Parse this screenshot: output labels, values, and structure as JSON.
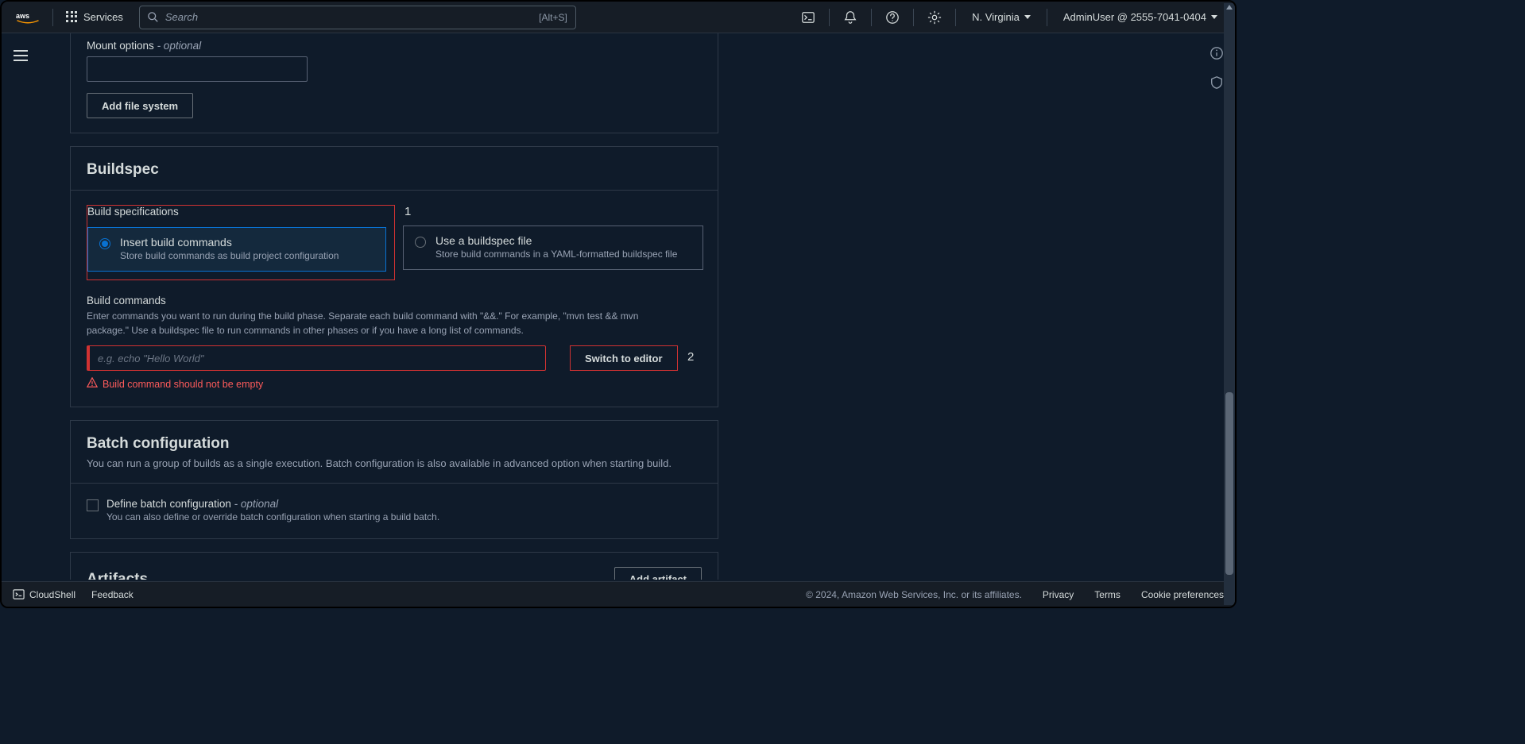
{
  "nav": {
    "services_label": "Services",
    "search_placeholder": "Search",
    "search_shortcut": "[Alt+S]",
    "region": "N. Virginia",
    "account": "AdminUser @ 2555-7041-0404"
  },
  "mount": {
    "label": "Mount options ",
    "optional": "- optional",
    "add_fs_btn": "Add file system"
  },
  "buildspec": {
    "title": "Buildspec",
    "spec_label": "Build specifications",
    "callout1": "1",
    "insert_title": "Insert build commands",
    "insert_desc": "Store build commands as build project configuration",
    "usefile_title": "Use a buildspec file",
    "usefile_desc": "Store build commands in a YAML-formatted buildspec file",
    "commands_label": "Build commands",
    "commands_help": "Enter commands you want to run during the build phase. Separate each build command with \"&&.\" For example, \"mvn test && mvn package.\" Use a buildspec file to run commands in other phases or if you have a long list of commands.",
    "commands_placeholder": "e.g. echo \"Hello World\"",
    "switch_btn": "Switch to editor",
    "callout2": "2",
    "error_msg": "Build command should not be empty"
  },
  "batch": {
    "title": "Batch configuration",
    "subtitle": "You can run a group of builds as a single execution. Batch configuration is also available in advanced option when starting build.",
    "checkbox_label": "Define batch configuration ",
    "checkbox_optional": "- optional",
    "checkbox_desc": "You can also define or override batch configuration when starting a build batch."
  },
  "artifacts": {
    "title": "Artifacts",
    "add_btn": "Add artifact"
  },
  "footer": {
    "cloudshell": "CloudShell",
    "feedback": "Feedback",
    "copyright": "© 2024, Amazon Web Services, Inc. or its affiliates.",
    "privacy": "Privacy",
    "terms": "Terms",
    "cookies": "Cookie preferences"
  }
}
